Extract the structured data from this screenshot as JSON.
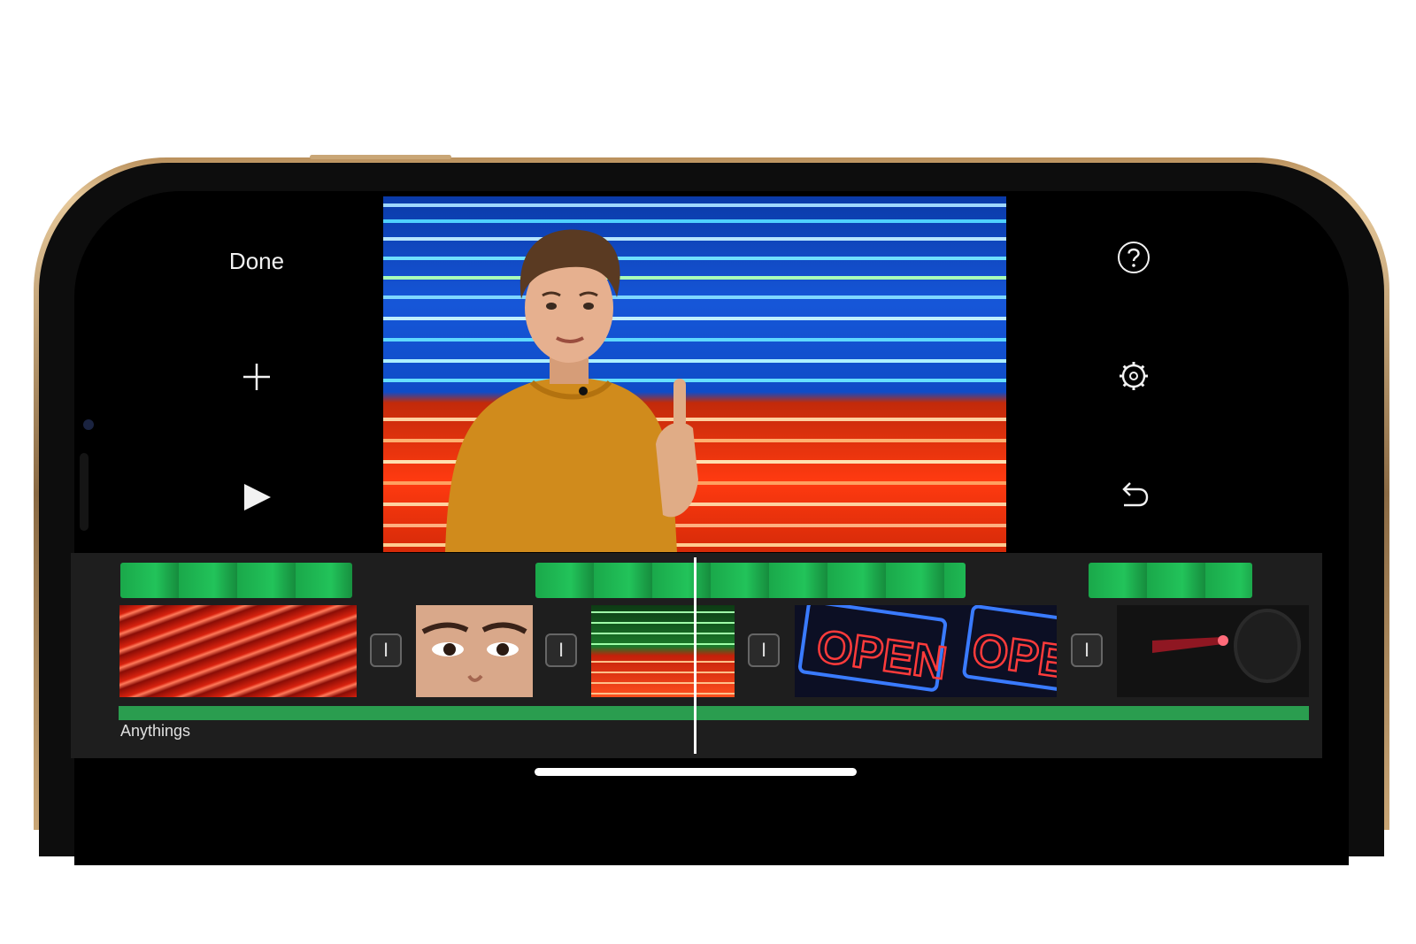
{
  "toolbar": {
    "done_label": "Done",
    "add_icon": "plus-icon",
    "play_icon": "play-icon",
    "help_icon": "help-icon",
    "settings_icon": "gear-icon",
    "undo_icon": "undo-icon"
  },
  "preview": {
    "description_color_top": "#1656d8",
    "description_color_bottom": "#ff3a10"
  },
  "timeline": {
    "transition_glyph": "I",
    "audio_track_label": "Anythings",
    "clips": [
      {
        "name": "red-neon-clip",
        "sign_text": ""
      },
      {
        "name": "eyes-closeup-clip",
        "sign_text": ""
      },
      {
        "name": "green-red-neon-clip",
        "sign_text": ""
      },
      {
        "name": "open-sign-clip",
        "sign_text": "OPEN"
      },
      {
        "name": "open-sign-clip-2",
        "sign_text": "OPE"
      },
      {
        "name": "red-light-clip",
        "sign_text": ""
      }
    ]
  },
  "colors": {
    "accent_green": "#2a9d4f",
    "greenscreen": "#22c35a",
    "frame_gold": "#c9a676"
  }
}
